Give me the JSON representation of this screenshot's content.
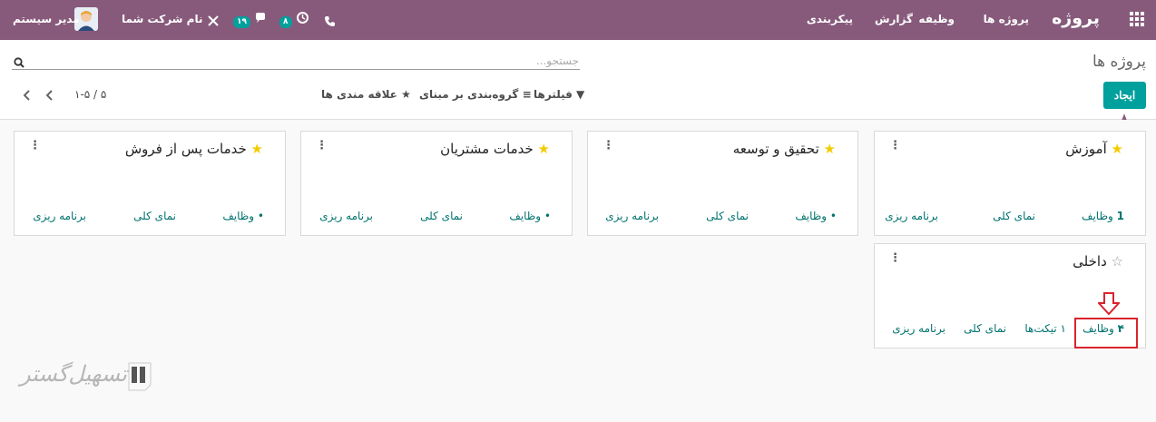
{
  "topbar": {
    "app_title": "پروژه",
    "menu": [
      "پروژه ها",
      "وظیفه",
      "گزارش",
      "پیکربندی"
    ],
    "user_name": "مدیر سیستم",
    "company_name": "نام شرکت شما",
    "messages_count": "۱۹",
    "activities_count": "۸"
  },
  "control": {
    "breadcrumb": "پروژه ها",
    "create_label": "ایجاد",
    "search_placeholder": "جستجو...",
    "filters_label": "فیلترها",
    "groupby_label": "گروه‌بندی بر مبنای",
    "favorites_label": "علاقه مندی ها",
    "pager_value": "۱-۵ / ۵"
  },
  "projects": [
    {
      "name": "آموزش",
      "starred": true,
      "tasks_label": "وظایف",
      "tasks_count": "1",
      "overview_label": "نمای کلی",
      "planning_label": "برنامه ریزی"
    },
    {
      "name": "تحقیق و توسعه",
      "starred": true,
      "tasks_label": "وظایف",
      "overview_label": "نمای کلی",
      "planning_label": "برنامه ریزی"
    },
    {
      "name": "خدمات مشتریان",
      "starred": true,
      "tasks_label": "وظایف",
      "overview_label": "نمای کلی",
      "planning_label": "برنامه ریزی"
    },
    {
      "name": "خدمات پس از فروش",
      "starred": true,
      "tasks_label": "وظایف",
      "overview_label": "نمای کلی",
      "planning_label": "برنامه ریزی"
    },
    {
      "name": "داخلی",
      "starred": false,
      "tasks_label": "وظایف",
      "tasks_count": "۴",
      "tickets_label": "۱ تیکت‌ها",
      "overview_label": "نمای کلی",
      "planning_label": "برنامه ریزی"
    }
  ],
  "watermark": "تسهیل‌گستر",
  "colors": {
    "brand": "#875a7b",
    "accent": "#00a09d",
    "link": "#00736e",
    "highlight": "#d9232d",
    "star": "#f3cc00"
  },
  "icons": [
    "apps-grid-icon",
    "phone-icon",
    "clock-icon",
    "chat-icon",
    "tools-icon",
    "avatar",
    "search-icon",
    "filter-icon",
    "list-icon",
    "star-icon",
    "chevron-left-icon",
    "chevron-right-icon",
    "kebab-icon",
    "drop-pin-icon",
    "down-arrow-icon"
  ]
}
